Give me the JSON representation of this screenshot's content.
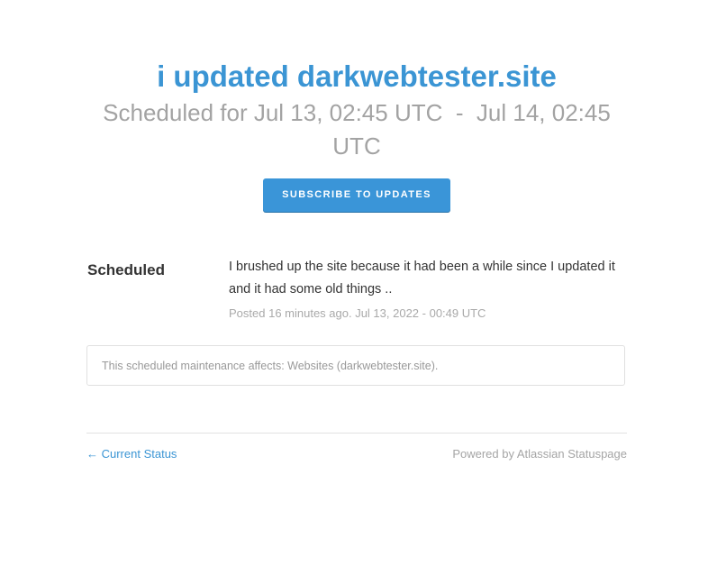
{
  "incident": {
    "title": "i updated darkwebtester.site",
    "schedule": "Scheduled for Jul 13, 02:45 UTC  -  Jul 14, 02:45 UTC"
  },
  "subscribe": {
    "label": "SUBSCRIBE TO UPDATES"
  },
  "update": {
    "status": "Scheduled",
    "body": "I brushed up the site because it had been a while since I updated it and it had some old things ..",
    "meta": "Posted 16 minutes ago. Jul 13, 2022 - 00:49 UTC"
  },
  "affected": {
    "text": "This scheduled maintenance affects: Websites (darkwebtester.site)."
  },
  "footer": {
    "back_label": "← Current Status",
    "powered_by": "Powered by Atlassian Statuspage"
  },
  "colors": {
    "accent": "#3b95d4",
    "button": "#3a95d8",
    "muted": "#a3a3a3",
    "text": "#333333"
  }
}
